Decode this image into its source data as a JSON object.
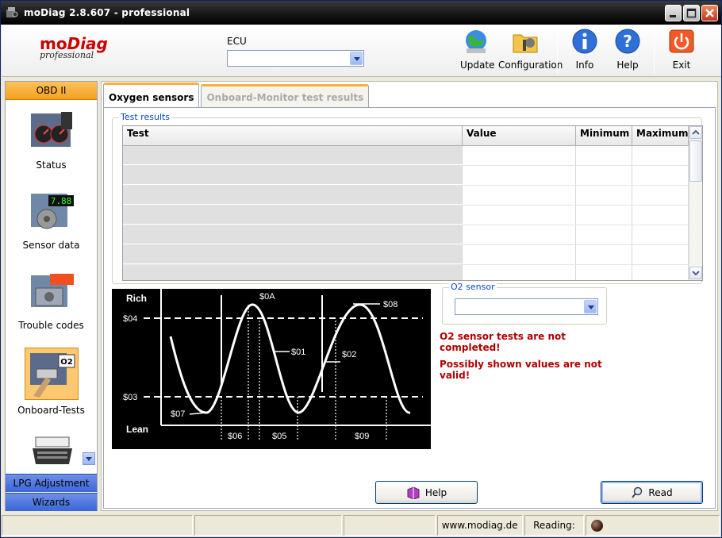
{
  "window": {
    "title": "moDiag 2.8.607 - professional"
  },
  "logo": {
    "brand_mo": "mo",
    "brand_diag": "Diag",
    "edition": "professional"
  },
  "ecu": {
    "label": "ECU",
    "value": ""
  },
  "toolbar": {
    "update": "Update",
    "configuration": "Configuration",
    "info": "Info",
    "help": "Help",
    "exit": "Exit"
  },
  "sidebar": {
    "header": "OBD II",
    "items": [
      {
        "label": "Status",
        "icon": "dashboard-icon"
      },
      {
        "label": "Sensor data",
        "icon": "engine-sensor-icon"
      },
      {
        "label": "Trouble codes",
        "icon": "engine-dtc-icon"
      },
      {
        "label": "Onboard-Tests",
        "icon": "o2-sensor-icon"
      },
      {
        "label": "",
        "icon": "typewriter-icon"
      }
    ],
    "footer": [
      "LPG Adjustment",
      "Wizards"
    ]
  },
  "tabs": [
    {
      "label": "Oxygen sensors",
      "active": true
    },
    {
      "label": "Onboard-Monitor test results",
      "active": false
    }
  ],
  "results": {
    "legend": "Test results",
    "columns": [
      "Test",
      "Value",
      "Minimum",
      "Maximum"
    ],
    "rows": [
      [
        "",
        "",
        "",
        ""
      ],
      [
        "",
        "",
        "",
        ""
      ],
      [
        "",
        "",
        "",
        ""
      ],
      [
        "",
        "",
        "",
        ""
      ],
      [
        "",
        "",
        "",
        ""
      ],
      [
        "",
        "",
        "",
        ""
      ],
      [
        "",
        "",
        "",
        ""
      ]
    ]
  },
  "diagram": {
    "rich": "Rich",
    "lean": "Lean",
    "labels": [
      "$04",
      "$03",
      "$0A",
      "$08",
      "$01",
      "$02",
      "$07",
      "$06",
      "$05",
      "$09"
    ]
  },
  "o2": {
    "legend": "O2 sensor",
    "value": ""
  },
  "warnings": {
    "not_completed": "O2 sensor tests are not completed!",
    "not_valid": "Possibly shown values are not valid!"
  },
  "buttons": {
    "help": "Help",
    "read": "Read"
  },
  "statusbar": {
    "url": "www.modiag.de",
    "reading_label": "Reading:"
  },
  "colors": {
    "accent_orange": "#f4a020",
    "sidebar_blue": "#3b66d9",
    "warning_red": "#b00000"
  }
}
